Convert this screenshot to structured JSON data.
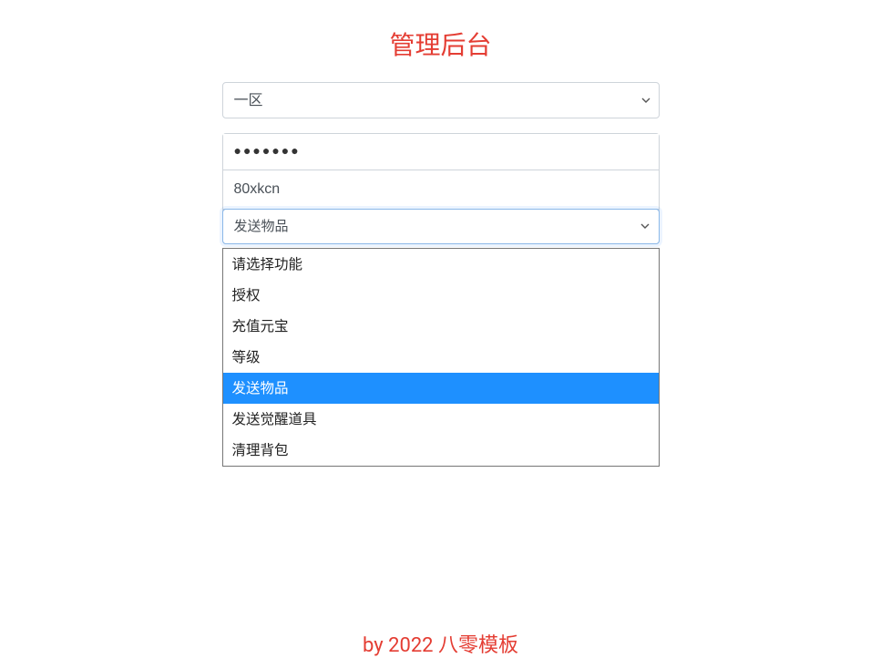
{
  "page_title": "管理后台",
  "zone_select": {
    "value": "一区"
  },
  "password_field": {
    "masked": "●●●●●●●"
  },
  "username_field": {
    "value": "80xkcn"
  },
  "function_select": {
    "value": "发送物品",
    "options": [
      "请选择功能",
      "授权",
      "充值元宝",
      "等级",
      "发送物品",
      "发送觉醒道具",
      "清理背包"
    ],
    "selected_index": 4
  },
  "footer": "by 2022 八零模板"
}
